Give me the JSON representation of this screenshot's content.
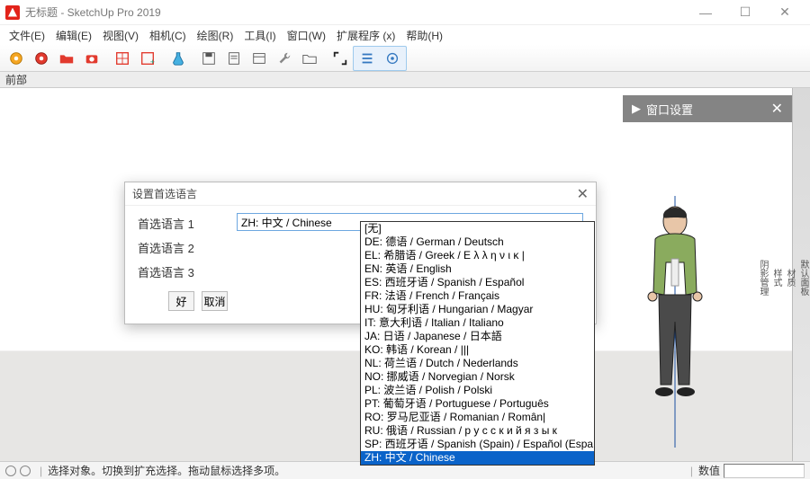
{
  "title": "无标题 - SketchUp Pro 2019",
  "menu": [
    "文件(E)",
    "编辑(E)",
    "视图(V)",
    "相机(C)",
    "绘图(R)",
    "工具(I)",
    "窗口(W)",
    "扩展程序 (x)",
    "帮助(H)"
  ],
  "view_label": "前部",
  "panel": {
    "title": "窗口设置"
  },
  "sidebar_tabs": [
    "默认面板",
    "材质",
    "样式",
    "阴影管理"
  ],
  "dialog": {
    "title": "设置首选语言",
    "label1": "首选语言 1",
    "label2": "首选语言 2",
    "label3": "首选语言 3",
    "selected_value": "ZH: 中文 / Chinese",
    "ok": "好",
    "cancel": "取消"
  },
  "languages": [
    "[无]",
    "DE: 德语 / German / Deutsch",
    "EL: 希腊语 / Greek / Ε λ λ η ν ι κ |",
    "EN: 英语 / English",
    "ES: 西班牙语 / Spanish / Español",
    "FR: 法语 / French / Français",
    "HU: 匈牙利语 / Hungarian / Magyar",
    "IT: 意大利语 / Italian / Italiano",
    "JA: 日语 / Japanese / 日本語",
    "KO: 韩语 / Korean / |||",
    "NL: 荷兰语 / Dutch / Nederlands",
    "NO: 挪威语 / Norvegian / Norsk",
    "PL: 波兰语 / Polish / Polski",
    "PT: 葡萄牙语 / Portuguese / Português",
    "RO: 罗马尼亚语 / Romanian / Român|",
    "RU: 俄语 / Russian / р у с с к и й   я з ы к",
    "SP: 西班牙语 / Spanish (Spain) / Español (España|",
    "ZH: 中文 / Chinese"
  ],
  "status": {
    "hint": "选择对象。切换到扩充选择。拖动鼠标选择多项。",
    "value_label": "数值"
  }
}
